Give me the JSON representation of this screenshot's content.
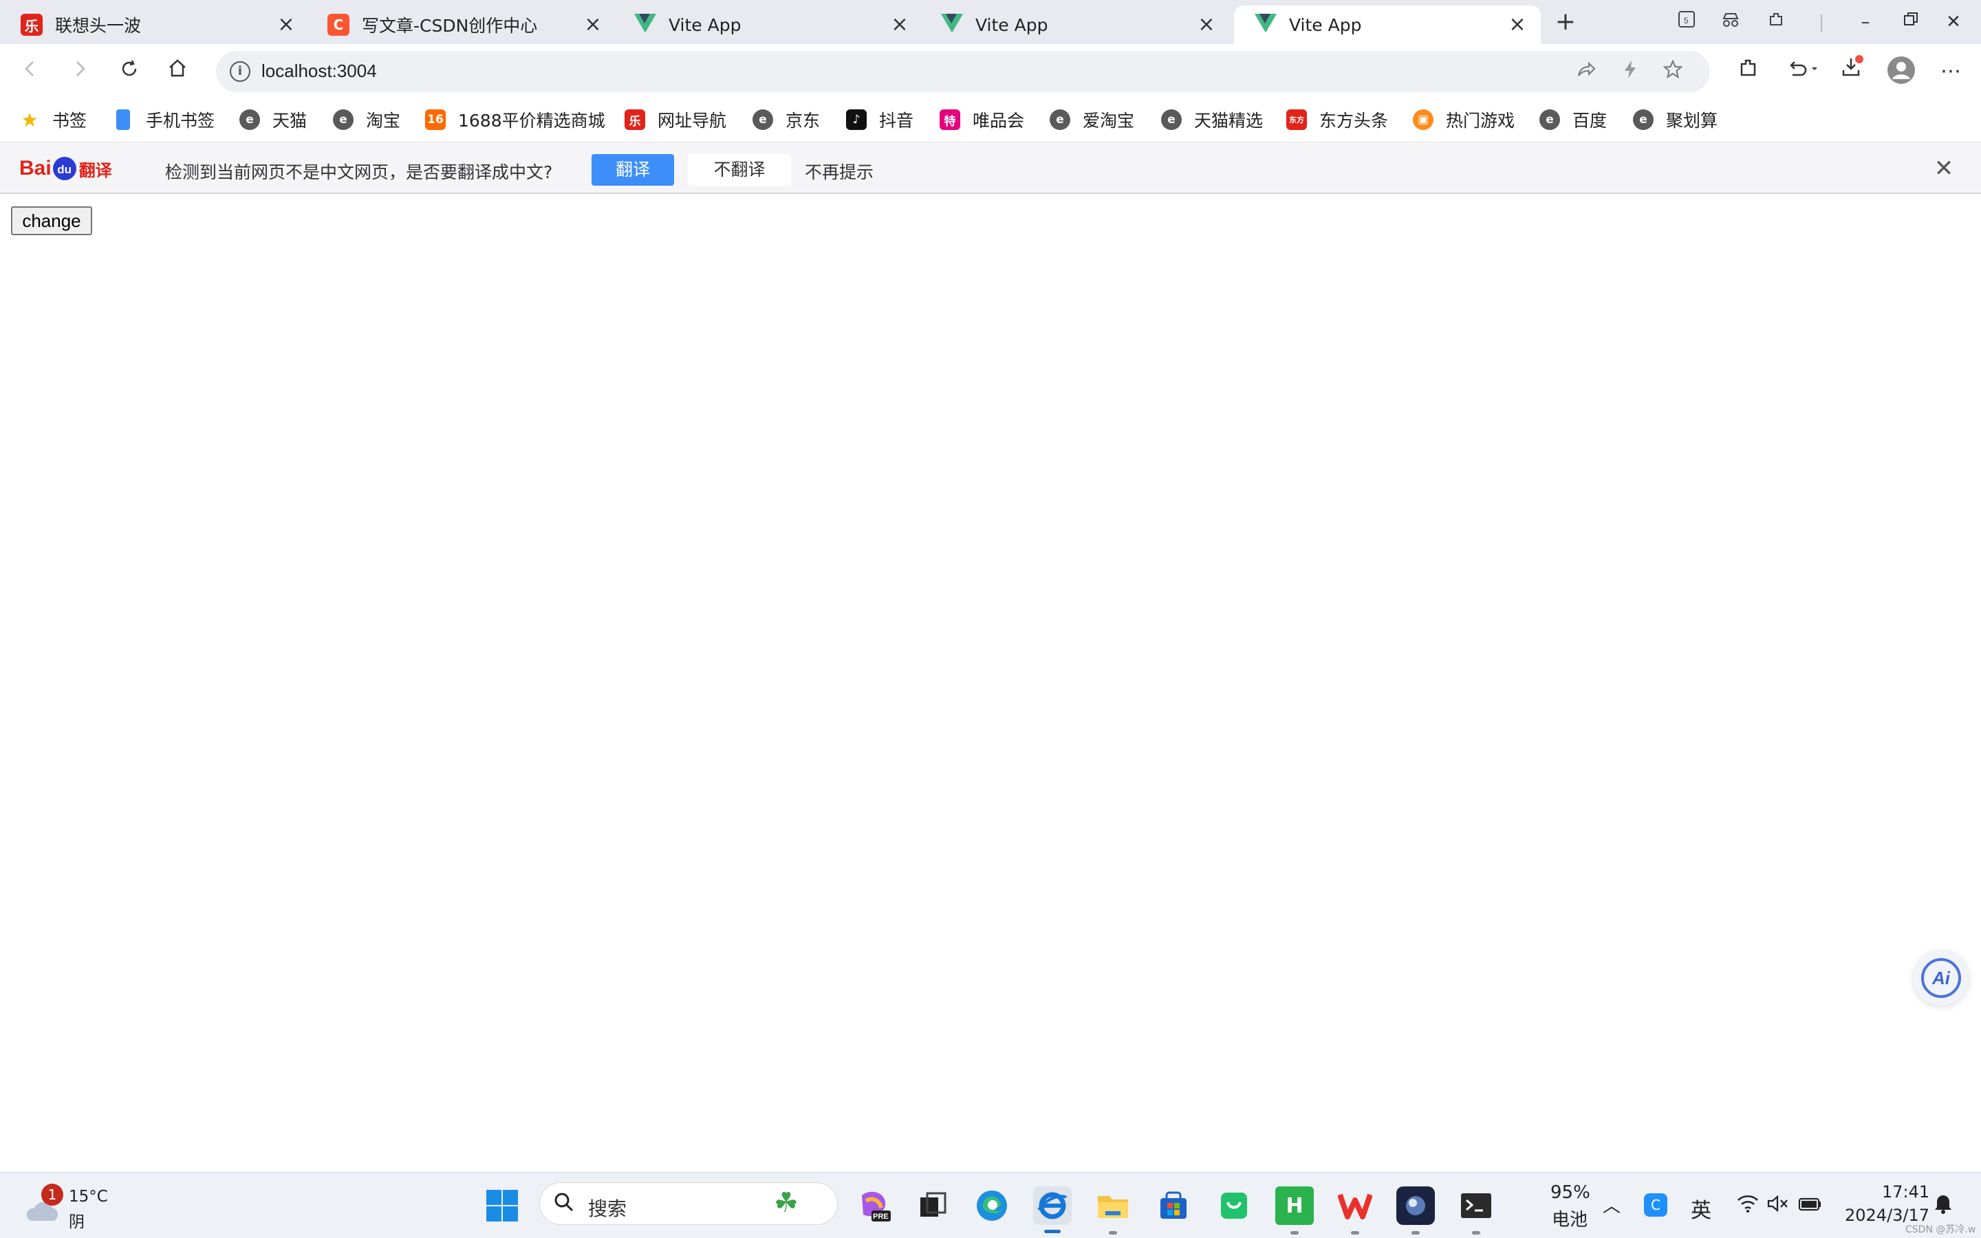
{
  "tabs": [
    {
      "title": "联想头一波",
      "favicon": "lenovo-red",
      "active": false
    },
    {
      "title": "写文章-CSDN创作中心",
      "favicon": "csdn-c",
      "active": false
    },
    {
      "title": "Vite App",
      "favicon": "vue-logo",
      "active": false
    },
    {
      "title": "Vite App",
      "favicon": "vue-logo",
      "active": false
    },
    {
      "title": "Vite App",
      "favicon": "vue-logo",
      "active": true
    }
  ],
  "new_tab_label": "+",
  "address_bar": {
    "url": "localhost:3004"
  },
  "bookmarks": [
    {
      "label": "书签",
      "icon": "star-icon",
      "color": "#f5b400"
    },
    {
      "label": "手机书签",
      "icon": "phone-icon",
      "color": "#3d8ef8"
    },
    {
      "label": "天猫",
      "icon": "e-browser-icon",
      "color": "#5a5a5a"
    },
    {
      "label": "淘宝",
      "icon": "e-browser-icon",
      "color": "#5a5a5a"
    },
    {
      "label": "1688平价精选商城",
      "icon": "1688-icon",
      "color": "#ff6a00"
    },
    {
      "label": "网址导航",
      "icon": "lenovo-red-icon",
      "color": "#e2231a"
    },
    {
      "label": "京东",
      "icon": "e-browser-icon",
      "color": "#5a5a5a"
    },
    {
      "label": "抖音",
      "icon": "tiktok-icon",
      "color": "#111111"
    },
    {
      "label": "唯品会",
      "icon": "vip-icon",
      "color": "#e6007e"
    },
    {
      "label": "爱淘宝",
      "icon": "e-browser-icon",
      "color": "#5a5a5a"
    },
    {
      "label": "天猫精选",
      "icon": "e-browser-icon",
      "color": "#5a5a5a"
    },
    {
      "label": "东方头条",
      "icon": "dongfang-icon",
      "color": "#e2231a"
    },
    {
      "label": "热门游戏",
      "icon": "game-icon",
      "color": "#ff8c1a"
    },
    {
      "label": "百度",
      "icon": "e-browser-icon",
      "color": "#5a5a5a"
    },
    {
      "label": "聚划算",
      "icon": "e-browser-icon",
      "color": "#5a5a5a"
    }
  ],
  "translate_bar": {
    "logo_bai": "Bai",
    "logo_du": "du",
    "logo_fanyi": "翻译",
    "message": "检测到当前网页不是中文网页，是否要翻译成中文?",
    "translate_label": "翻译",
    "no_translate_label": "不翻译",
    "never_label": "不再提示"
  },
  "page": {
    "change_button": "change"
  },
  "ai_assistant": {
    "label": "Ai"
  },
  "taskbar": {
    "weather": {
      "badge": "1",
      "temp": "15°C",
      "condition": "阴"
    },
    "search_label": "搜索",
    "battery_percent": "95%",
    "battery_label": "电池",
    "ime": "英",
    "time": "17:41",
    "date": "2024/3/17"
  },
  "watermark": "CSDN @苏冷.w"
}
